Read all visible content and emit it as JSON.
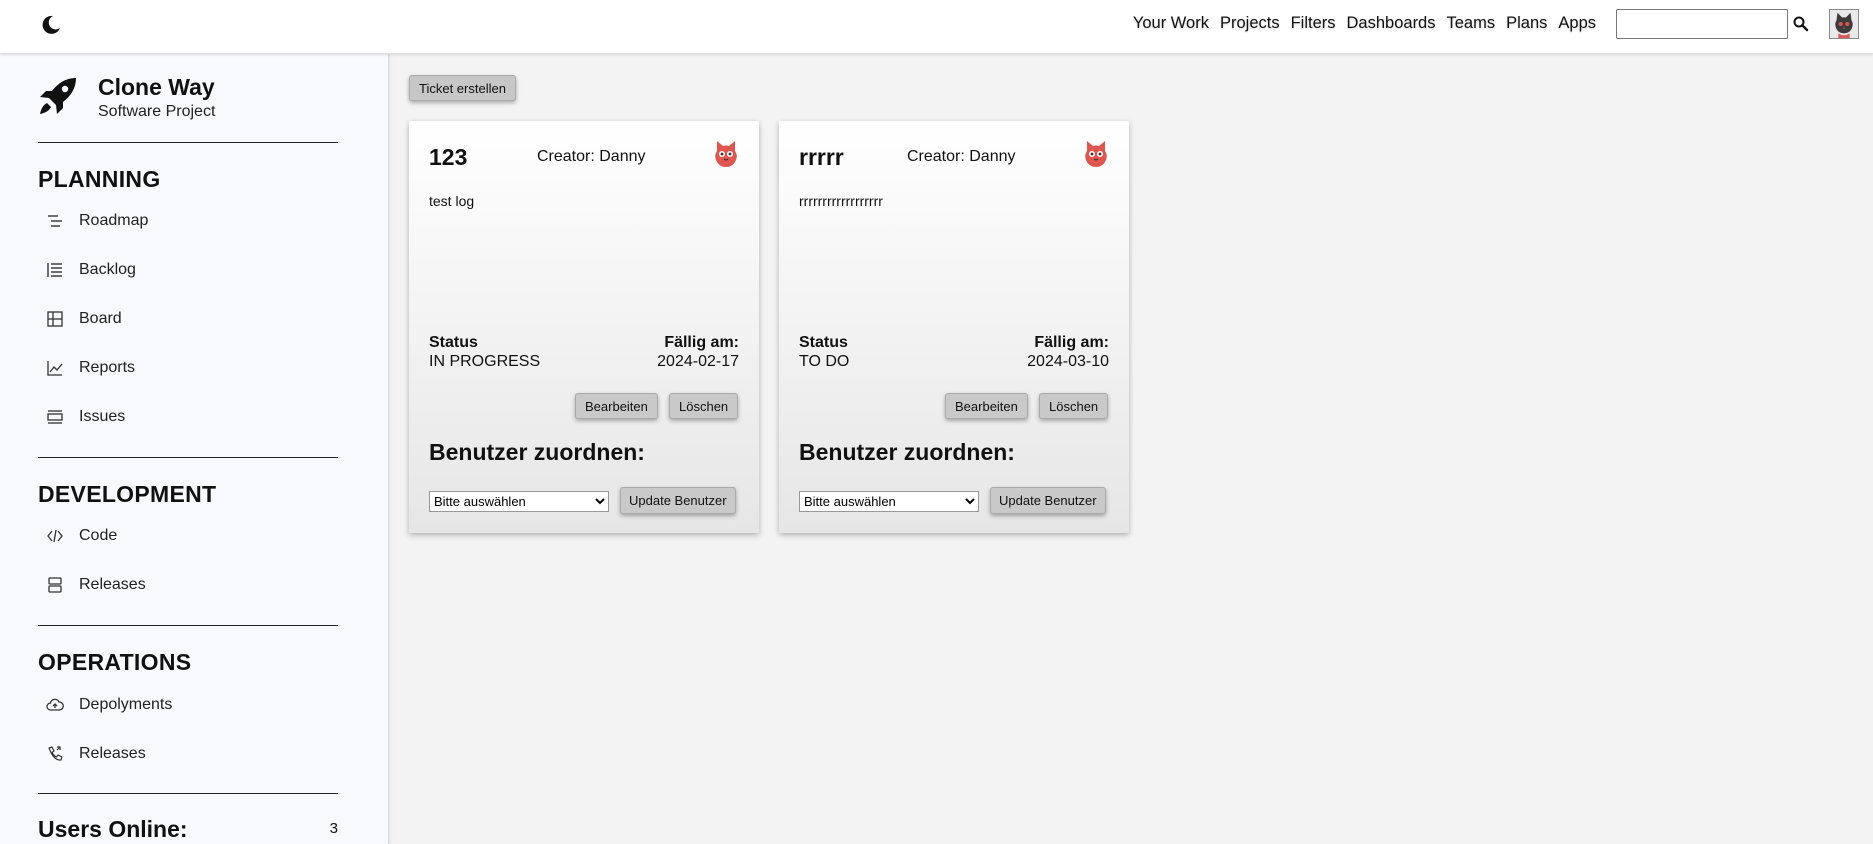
{
  "topbar": {
    "theme_icon": "moon-icon",
    "nav": [
      "Your Work",
      "Projects",
      "Filters",
      "Dashboards",
      "Teams",
      "Plans",
      "Apps"
    ],
    "search_value": "",
    "search_icon": "search-icon",
    "avatar_icon": "cat-avatar-icon"
  },
  "sidebar": {
    "logo_icon": "rocket-icon",
    "project_name": "Clone Way",
    "project_type": "Software Project",
    "sections": [
      {
        "title": "PLANNING",
        "items": [
          {
            "label": "Roadmap",
            "icon": "roadmap-icon"
          },
          {
            "label": "Backlog",
            "icon": "backlog-icon"
          },
          {
            "label": "Board",
            "icon": "board-icon"
          },
          {
            "label": "Reports",
            "icon": "chart-icon"
          },
          {
            "label": "Issues",
            "icon": "issues-icon"
          }
        ]
      },
      {
        "title": "DEVELOPMENT",
        "items": [
          {
            "label": "Code",
            "icon": "code-icon"
          },
          {
            "label": "Releases",
            "icon": "server-icon"
          }
        ]
      },
      {
        "title": "OPERATIONS",
        "items": [
          {
            "label": "Depolyments",
            "icon": "cloud-upload-icon"
          },
          {
            "label": "Releases",
            "icon": "phone-icon"
          }
        ]
      }
    ],
    "users_online_label": "Users Online:",
    "users_online_count": "3"
  },
  "main": {
    "create_ticket_label": "Ticket erstellen",
    "tickets": [
      {
        "title": "123",
        "creator": "Creator: Danny",
        "description": "test log",
        "status_label": "Status",
        "status": "IN PROGRESS",
        "due_label": "Fällig am:",
        "due_date": "2024-02-17",
        "edit_label": "Bearbeiten",
        "delete_label": "Löschen",
        "assign_title": "Benutzer zuordnen:",
        "select_value": "Bitte auswählen",
        "update_label": "Update Benutzer"
      },
      {
        "title": "rrrrr",
        "creator": "Creator: Danny",
        "description": "rrrrrrrrrrrrrrrrrr",
        "status_label": "Status",
        "status": "TO DO",
        "due_label": "Fällig am:",
        "due_date": "2024-03-10",
        "edit_label": "Bearbeiten",
        "delete_label": "Löschen",
        "assign_title": "Benutzer zuordnen:",
        "select_value": "Bitte auswählen",
        "update_label": "Update Benutzer"
      }
    ]
  },
  "colors": {
    "page_bg": "#f3f3f3",
    "sidebar_bg": "#f8f9fc",
    "button_bg": "#c9c9c9",
    "avatar_red": "#e0564f"
  }
}
